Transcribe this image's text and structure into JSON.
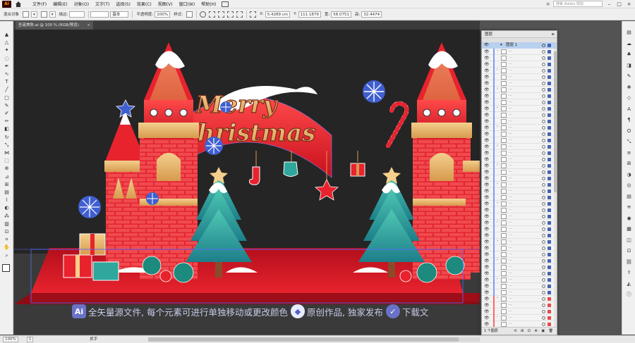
{
  "menubar": {
    "logo": "Ai",
    "items": [
      "文件(F)",
      "编辑(E)",
      "对象(O)",
      "文字(T)",
      "选择(S)",
      "效果(C)",
      "视图(V)",
      "窗口(W)",
      "帮助(H)"
    ],
    "search_placeholder": "搜索 Adobe 帮助"
  },
  "controlbar": {
    "selection": "混合对象",
    "stroke_label": "描边:",
    "style_label": "基本",
    "opacity_label": "不透明度:",
    "opacity_value": "100%",
    "style2_label": "样式:",
    "x_label": "X:",
    "x_value": "5.4289 cm",
    "y_label": "Y:",
    "y_value": "111.1879",
    "w_label": "宽:",
    "w_value": "58.0751",
    "h_label": "高:",
    "h_value": "32.4474"
  },
  "document": {
    "tab_title": "圣诞美陈.ai @ 100 % (RGB/预览)",
    "close": "×"
  },
  "artwork": {
    "title_line1": "Merry",
    "title_line2": "Christmas",
    "caption": {
      "ai_badge": "Ai",
      "text1": "全矢量源文件, 每个元素可进行单独移动或更改颜色",
      "text2": "原创作品, 独家发布",
      "text3": "下载文"
    },
    "colors": {
      "red": "#e8232e",
      "gold": "#e8b66c",
      "teal": "#2fa79c",
      "floor": "#c41321",
      "bg": "#252525"
    }
  },
  "layers_panel": {
    "title": "图层",
    "layer_name": "图层 1",
    "footer_label": "1 个图层"
  },
  "statusbar": {
    "zoom": "100%",
    "artboard": "1",
    "tool": "抓手"
  },
  "tools": [
    "selection-icon",
    "direct-select-icon",
    "magic-wand-icon",
    "lasso-icon",
    "pen-icon",
    "curvature-icon",
    "type-icon",
    "line-icon",
    "rectangle-icon",
    "paintbrush-icon",
    "shaper-icon",
    "pencil-icon",
    "eraser-icon",
    "rotate-icon",
    "scale-icon",
    "width-icon",
    "free-transform-icon",
    "shape-builder-icon",
    "perspective-icon",
    "mesh-icon",
    "gradient-icon",
    "eyedropper-icon",
    "blend-icon",
    "symbol-sprayer-icon",
    "column-graph-icon",
    "artboard-icon",
    "slice-icon",
    "hand-icon",
    "zoom-icon"
  ]
}
